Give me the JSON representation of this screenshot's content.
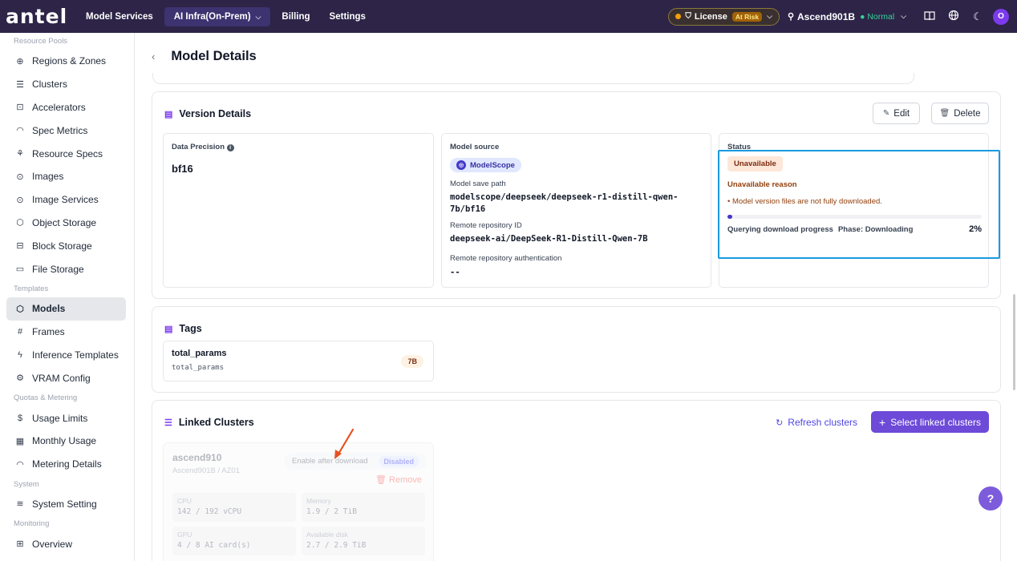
{
  "topbar": {
    "logo": "antel",
    "nav": [
      {
        "label": "Model Services"
      },
      {
        "label": "AI Infra(On-Prem)"
      },
      {
        "label": "Billing"
      },
      {
        "label": "Settings"
      }
    ],
    "license_label": "License",
    "license_status": "At Risk",
    "cluster_name": "Ascend901B",
    "cluster_status": "Normal",
    "avatar": "O"
  },
  "sidebar": {
    "sections": [
      {
        "title": "Resource Pools",
        "items": [
          "Regions & Zones",
          "Clusters",
          "Accelerators",
          "Spec Metrics",
          "Resource Specs",
          "Images",
          "Image Services",
          "Object Storage",
          "Block Storage",
          "File Storage"
        ]
      },
      {
        "title": "Templates",
        "items": [
          "Models",
          "Frames",
          "Inference Templates",
          "VRAM Config"
        ]
      },
      {
        "title": "Quotas & Metering",
        "items": [
          "Usage Limits",
          "Monthly Usage",
          "Metering Details"
        ]
      },
      {
        "title": "System",
        "items": [
          "System Setting"
        ]
      },
      {
        "title": "Monitoring",
        "items": [
          "Overview"
        ]
      }
    ],
    "active_item": "Models"
  },
  "page": {
    "title": "Model Details"
  },
  "version_details": {
    "title": "Version Details",
    "edit_label": "Edit",
    "delete_label": "Delete",
    "precision_label": "Data Precision",
    "precision_value": "bf16",
    "source_label": "Model source",
    "source_value": "ModelScope",
    "save_path_label": "Model save path",
    "save_path_line1": "modelscope/deepseek/deepseek-r1-distill-qwen-",
    "save_path_line2": "7b/bf16",
    "repo_id_label": "Remote repository ID",
    "repo_id_value": "deepseek-ai/DeepSeek-R1-Distill-Qwen-7B",
    "repo_auth_label": "Remote repository authentication",
    "repo_auth_value": "--",
    "status_label": "Status",
    "status_value": "Unavailable",
    "reason_title": "Unavailable reason",
    "reason_text": "Model version files are not fully downloaded.",
    "progress_label": "Querying download progress",
    "phase_label": "Phase: Downloading",
    "progress_percent_text": "2%",
    "progress_fraction": 0.02
  },
  "tags": {
    "title": "Tags",
    "items": [
      {
        "key": "total_params",
        "value": "total_params",
        "badge": "7B"
      }
    ]
  },
  "linked_clusters": {
    "title": "Linked Clusters",
    "refresh_label": "Refresh clusters",
    "select_label": "Select linked clusters",
    "clusters": [
      {
        "name": "ascend910",
        "location": "Ascend901B / AZ01",
        "enable_label": "Enable after download",
        "state": "Disabled",
        "remove_label": "Remove",
        "metrics": [
          {
            "label": "CPU",
            "value": "142 / 192 vCPU"
          },
          {
            "label": "Memory",
            "value": "1.9 / 2 TiB"
          },
          {
            "label": "GPU",
            "value": "4 / 8 AI card(s)"
          },
          {
            "label": "Available disk",
            "value": "2.7 / 2.9 TiB"
          }
        ]
      }
    ]
  },
  "colors": {
    "topbar_bg": "#2d2447",
    "accent": "#6d4ad8",
    "highlight_outline": "#1a9ae0",
    "annotation_arrow": "#e8501f"
  },
  "icons": {
    "help": "?"
  }
}
